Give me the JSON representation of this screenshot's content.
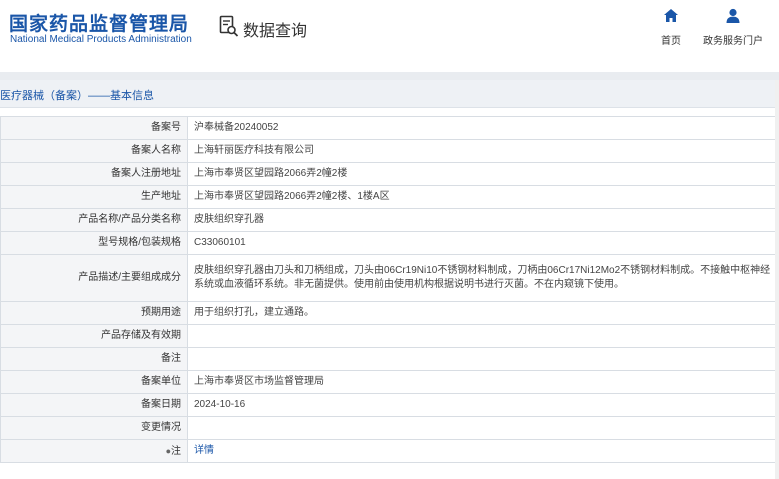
{
  "header": {
    "logo_cn": "国家药品监督管理局",
    "logo_en": "National Medical Products Administration",
    "search_label": "数据查询",
    "nav": [
      {
        "label": "首页",
        "icon": "home-icon"
      },
      {
        "label": "政务服务门户",
        "icon": "user-icon"
      }
    ]
  },
  "breadcrumb": "医疗器械（备案）——基本信息",
  "rows": [
    {
      "key": "备案号",
      "value": "沪奉械备20240052"
    },
    {
      "key": "备案人名称",
      "value": "上海轩丽医疗科技有限公司"
    },
    {
      "key": "备案人注册地址",
      "value": "上海市奉贤区望园路2066弄2幢2楼"
    },
    {
      "key": "生产地址",
      "value": "上海市奉贤区望园路2066弄2幢2楼、1楼A区"
    },
    {
      "key": "产品名称/产品分类名称",
      "value": "皮肤组织穿孔器"
    },
    {
      "key": "型号规格/包装规格",
      "value": "C33060101"
    },
    {
      "key": "产品描述/主要组成成分",
      "value": "皮肤组织穿孔器由刀头和刀柄组成，刀头由06Cr19Ni10不锈钢材料制成，刀柄由06Cr17Ni12Mo2不锈钢材料制成。不接触中枢神经系统或血液循环系统。非无菌提供。使用前由使用机构根据说明书进行灭菌。不在内窥镜下使用。"
    },
    {
      "key": "预期用途",
      "value": "用于组织打孔，建立通路。"
    },
    {
      "key": "产品存储及有效期",
      "value": ""
    },
    {
      "key": "备注",
      "value": ""
    },
    {
      "key": "备案单位",
      "value": "上海市奉贤区市场监督管理局"
    },
    {
      "key": "备案日期",
      "value": "2024-10-16"
    },
    {
      "key": "变更情况",
      "value": ""
    }
  ],
  "note_row": {
    "key": "注",
    "value": "详情"
  }
}
